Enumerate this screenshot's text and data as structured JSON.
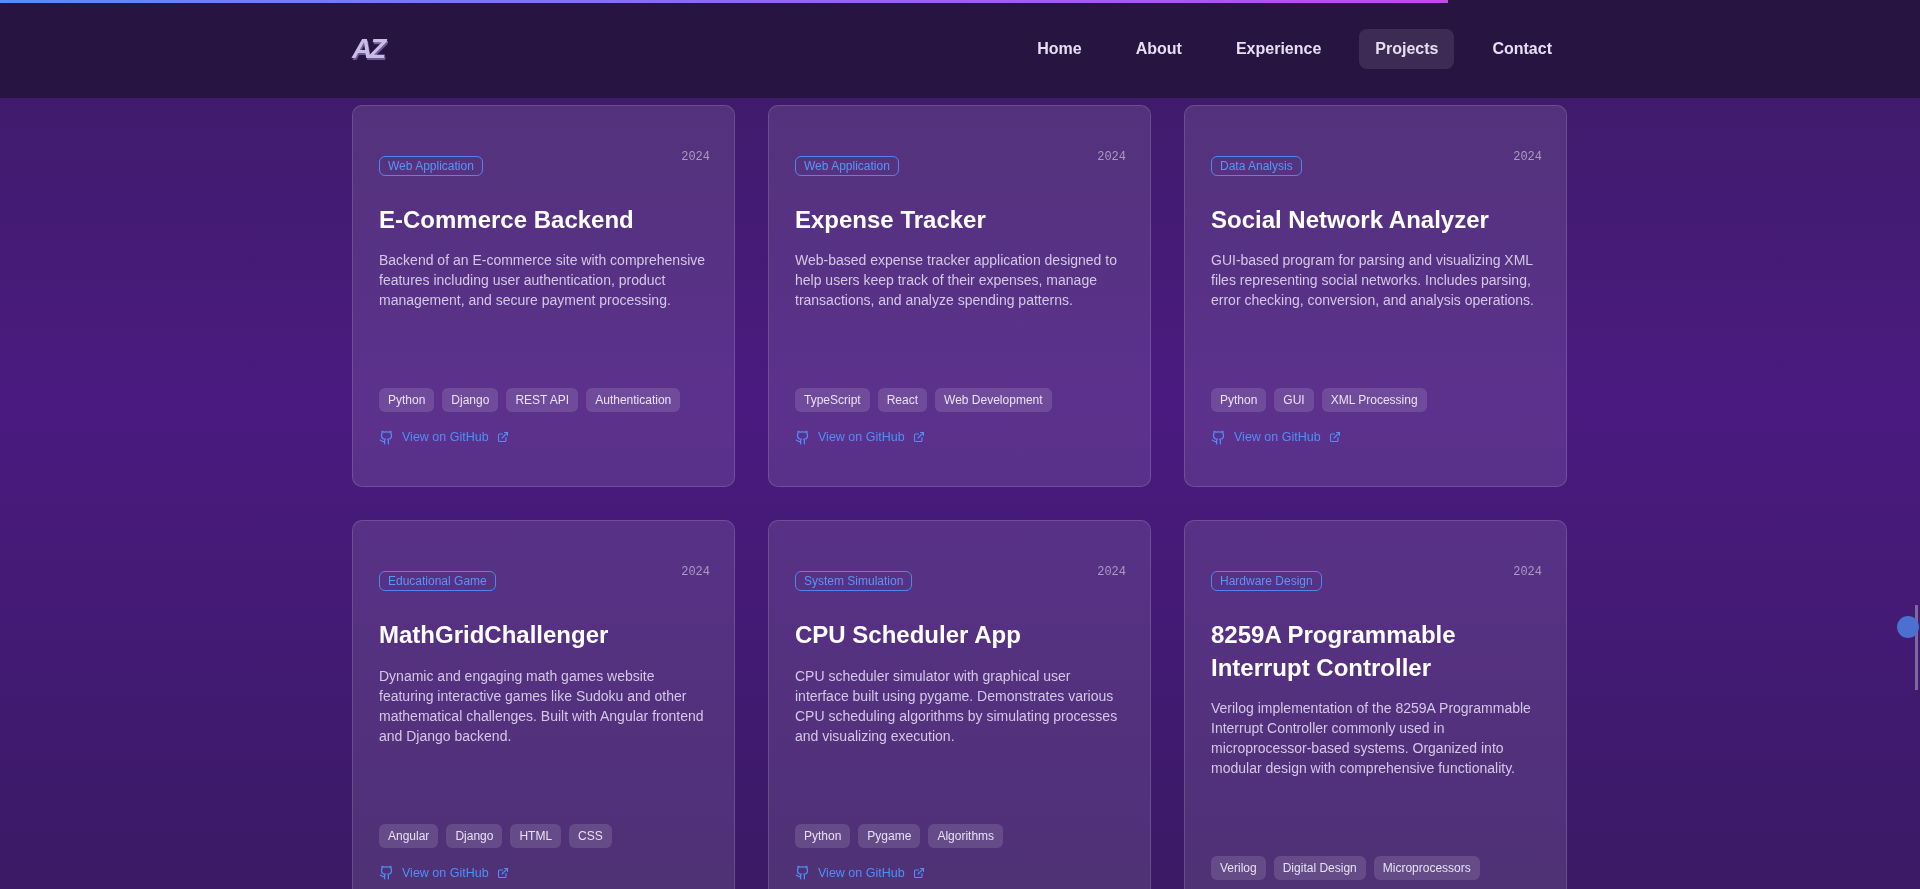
{
  "reading_progress": {
    "level": 0.754
  },
  "header": {
    "logo": "AZ",
    "nav": [
      {
        "label": "Home",
        "selected": false
      },
      {
        "label": "About",
        "selected": false
      },
      {
        "label": "Experience",
        "selected": false
      },
      {
        "label": "Projects",
        "selected": true
      },
      {
        "label": "Contact",
        "selected": false
      }
    ]
  },
  "projects": [
    {
      "category": "Web Application",
      "year": "2024",
      "title": "E-Commerce Backend",
      "description": "Backend of an E-commerce site with comprehensive features including user authentication, product management, and secure payment processing.",
      "tags": [
        "Python",
        "Django",
        "REST API",
        "Authentication"
      ],
      "link": "View on GitHub"
    },
    {
      "category": "Web Application",
      "year": "2024",
      "title": "Expense Tracker",
      "description": "Web-based expense tracker application designed to help users keep track of their expenses, manage transactions, and analyze spending patterns.",
      "tags": [
        "TypeScript",
        "React",
        "Web Development"
      ],
      "link": "View on GitHub"
    },
    {
      "category": "Data Analysis",
      "year": "2024",
      "title": "Social Network Analyzer",
      "description": "GUI-based program for parsing and visualizing XML files representing social networks. Includes parsing, error checking, conversion, and analysis operations.",
      "tags": [
        "Python",
        "GUI",
        "XML Processing"
      ],
      "link": "View on GitHub"
    },
    {
      "category": "Educational Game",
      "year": "2024",
      "title": "MathGridChallenger",
      "description": "Dynamic and engaging math games website featuring interactive games like Sudoku and other mathematical challenges. Built with Angular frontend and Django backend.",
      "tags": [
        "Angular",
        "Django",
        "HTML",
        "CSS"
      ],
      "link": "View on GitHub"
    },
    {
      "category": "System Simulation",
      "year": "2024",
      "title": "CPU Scheduler App",
      "description": "CPU scheduler simulator with graphical user interface built using pygame. Demonstrates various CPU scheduling algorithms by simulating processes and visualizing execution.",
      "tags": [
        "Python",
        "Pygame",
        "Algorithms"
      ],
      "link": "View on GitHub"
    },
    {
      "category": "Hardware Design",
      "year": "2024",
      "title": "8259A Programmable Interrupt Controller",
      "description": "Verilog implementation of the 8259A Programmable Interrupt Controller commonly used in microprocessor-based systems. Organized into modular design with comprehensive functionality.",
      "tags": [
        "Verilog",
        "Digital Design",
        "Microprocessors"
      ]
    }
  ]
}
